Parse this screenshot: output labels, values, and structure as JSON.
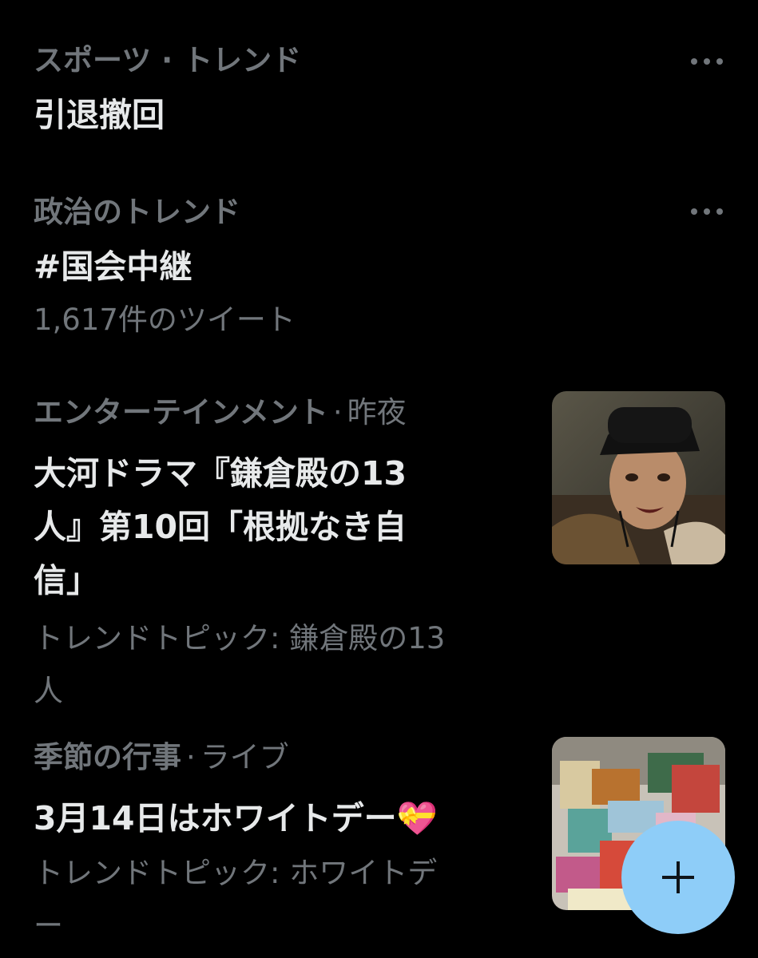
{
  "trends": [
    {
      "category": "スポーツ · トレンド",
      "title": "引退撤回"
    },
    {
      "category": "政治のトレンド",
      "title": "#国会中継",
      "subtitle": "1,617件のツイート"
    },
    {
      "category": "エンターテインメント",
      "time": "昨夜",
      "title_lines": [
        "大河ドラマ『鎌倉殿の13",
        "人』第10回「根拠なき自",
        "信」"
      ],
      "subtitle_lines": [
        "トレンドトピック: 鎌倉殿の13",
        "人"
      ],
      "thumbnail_icon": "drama-actor-thumbnail"
    },
    {
      "category": "季節の行事",
      "time": "ライブ",
      "title": "3月14日はホワイトデー💝",
      "subtitle_lines": [
        "トレンドトピック: ホワイトデ",
        "ー"
      ],
      "thumbnail_icon": "gift-boxes-thumbnail"
    }
  ],
  "more_icon": "more-options-icon",
  "fab": {
    "icon": "plus-icon",
    "color": "#8ecdf8"
  },
  "colors": {
    "background": "#000000",
    "primary_text": "#e7e9ea",
    "secondary_text": "#71767b",
    "accent": "#8ecdf8"
  }
}
